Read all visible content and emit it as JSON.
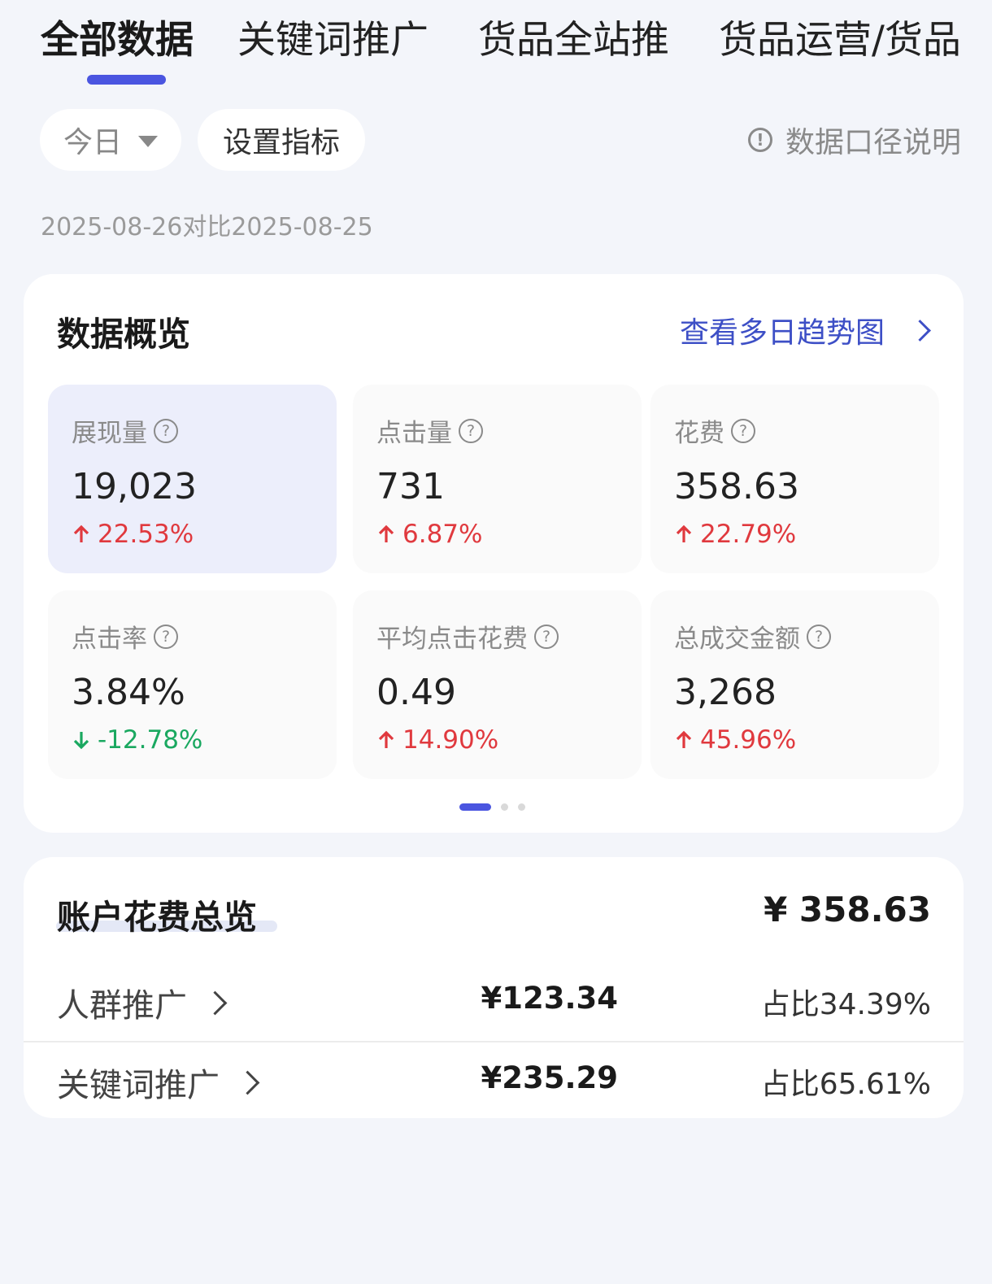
{
  "tabs": [
    "全部数据",
    "关键词推广",
    "货品全站推",
    "货品运营/货品"
  ],
  "filters": {
    "date_label": "今日",
    "metric_button": "设置指标",
    "explain_label": "数据口径说明"
  },
  "compare_date": "2025-08-26对比2025-08-25",
  "overview": {
    "title": "数据概览",
    "trend_link": "查看多日趋势图",
    "metrics": [
      {
        "label": "展现量",
        "value": "19,023",
        "change": "22.53%",
        "direction": "up"
      },
      {
        "label": "点击量",
        "value": "731",
        "change": "6.87%",
        "direction": "up"
      },
      {
        "label": "花费",
        "value": "358.63",
        "change": "22.79%",
        "direction": "up"
      },
      {
        "label": "点击率",
        "value": "3.84%",
        "change": "-12.78%",
        "direction": "down"
      },
      {
        "label": "平均点击花费",
        "value": "0.49",
        "change": "14.90%",
        "direction": "up"
      },
      {
        "label": "总成交金额",
        "value": "3,268",
        "change": "45.96%",
        "direction": "up"
      }
    ]
  },
  "spend": {
    "title": "账户花费总览",
    "total": "¥ 358.63",
    "rows": [
      {
        "name": "人群推广",
        "amount": "¥123.34",
        "share": "占比34.39%"
      },
      {
        "name": "关键词推广",
        "amount": "¥235.29",
        "share": "占比65.61%"
      }
    ]
  },
  "colors": {
    "accent": "#4a55e0",
    "up": "#e0393e",
    "down": "#1aa860",
    "link": "#3d4fc6"
  }
}
